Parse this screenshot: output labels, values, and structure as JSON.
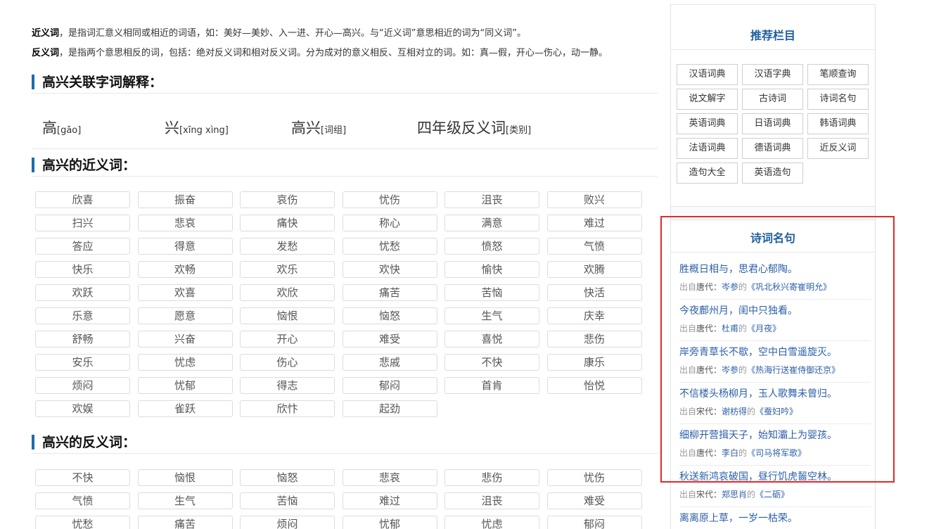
{
  "definitions": {
    "synonym_term": "近义词",
    "synonym_text": "，是指词汇意义相同或相近的词语，如：美好—美妙、入一进、开心—高兴。与“近义词”意思相近的词为“同义词”。",
    "antonym_term": "反义词",
    "antonym_text": "，是指两个意思相反的词，包括：绝对反义词和相对反义词。分为成对的意义相反、互相对立的词。如：真—假，开心—伤心，动一静。"
  },
  "sections": {
    "chars_title": "高兴关联字词解释：",
    "synonyms_title": "高兴的近义词：",
    "antonyms_title": "高兴的反义词："
  },
  "chars": [
    {
      "word": "高",
      "note": "[gāo]"
    },
    {
      "word": "兴",
      "note": "[xīng xìng]"
    },
    {
      "word": "高兴",
      "note": "[词组]"
    },
    {
      "word": "四年级反义词",
      "note": "[类别]"
    }
  ],
  "synonyms": [
    "欣喜",
    "振奋",
    "哀伤",
    "忧伤",
    "沮丧",
    "败兴",
    "扫兴",
    "悲哀",
    "痛快",
    "称心",
    "满意",
    "难过",
    "答应",
    "得意",
    "发愁",
    "忧愁",
    "愤怒",
    "气愤",
    "快乐",
    "欢畅",
    "欢乐",
    "欢快",
    "愉快",
    "欢腾",
    "欢跃",
    "欢喜",
    "欢欣",
    "痛苦",
    "苦恼",
    "快活",
    "乐意",
    "愿意",
    "恼恨",
    "恼怒",
    "生气",
    "庆幸",
    "舒畅",
    "兴奋",
    "开心",
    "难受",
    "喜悦",
    "悲伤",
    "安乐",
    "忧虑",
    "伤心",
    "悲戚",
    "不快",
    "康乐",
    "烦闷",
    "忧郁",
    "得志",
    "郁闷",
    "首肯",
    "怡悦",
    "欢娱",
    "雀跃",
    "欣忭",
    "起劲"
  ],
  "antonyms": [
    "不快",
    "恼恨",
    "恼怒",
    "悲哀",
    "悲伤",
    "忧伤",
    "气愤",
    "生气",
    "苦恼",
    "难过",
    "沮丧",
    "难受",
    "忧愁",
    "痛苦",
    "烦闷",
    "忧郁",
    "忧虑",
    "郁闷"
  ],
  "sidebar": {
    "recommend_title": "推荐栏目",
    "recommend": [
      "汉语词典",
      "汉语字典",
      "笔顺查询",
      "说文解字",
      "古诗词",
      "诗词名句",
      "英语词典",
      "日语词典",
      "韩语词典",
      "法语词典",
      "德语词典",
      "近反义词",
      "造句大全",
      "英语造句"
    ],
    "poems_title": "诗词名句",
    "source_prefix": "出自",
    "de": "的",
    "quote_open": "《",
    "quote_close": "》",
    "poems": [
      {
        "line": "胜概日相与，思君心郁陶。",
        "dynasty": "唐代：",
        "author": "岑参",
        "title": "巩北秋兴寄崔明允"
      },
      {
        "line": "今夜鄜州月，闺中只独看。",
        "dynasty": "唐代：",
        "author": "杜甫",
        "title": "月夜"
      },
      {
        "line": "岸旁青草长不歇，空中白雪遥旋灭。",
        "dynasty": "唐代：",
        "author": "岑参",
        "title": "热海行送崔侍御还京"
      },
      {
        "line": "不信楼头杨柳月，玉人歌舞未曾归。",
        "dynasty": "宋代：",
        "author": "谢枋得",
        "title": "蚕妇吟"
      },
      {
        "line": "细柳开营揖天子，始知灞上为婴孩。",
        "dynasty": "唐代：",
        "author": "李白",
        "title": "司马将军歌"
      },
      {
        "line": "秋送新鸿哀破国，昼行饥虎齧空林。",
        "dynasty": "宋代：",
        "author": "郑思肖",
        "title": "二砺"
      },
      {
        "line": "离离原上草，一岁一枯荣。",
        "dynasty": "",
        "author": "",
        "title": ""
      }
    ]
  }
}
